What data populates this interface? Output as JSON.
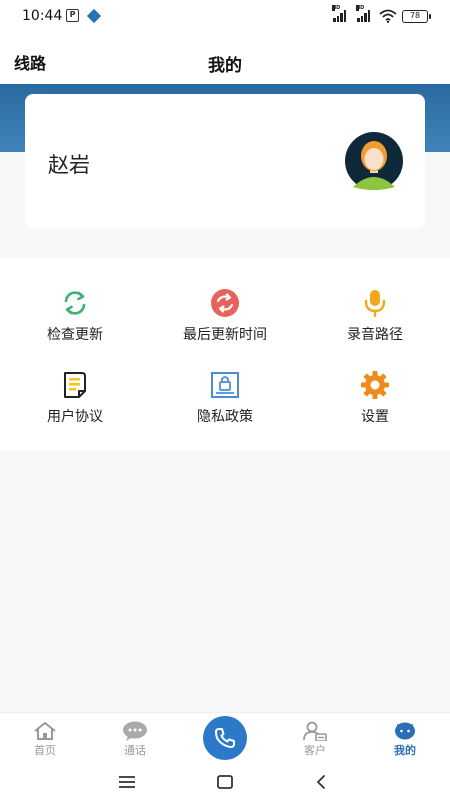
{
  "status_bar": {
    "time": "10:44",
    "battery": "78",
    "network_label": "HD"
  },
  "header": {
    "left_label": "线路",
    "title": "我的"
  },
  "profile": {
    "name": "赵岩"
  },
  "menu": {
    "items": [
      {
        "label": "检查更新",
        "icon": "refresh-icon",
        "color": "#3cb371"
      },
      {
        "label": "最后更新时间",
        "icon": "sync-circle-icon",
        "color": "#e8615a"
      },
      {
        "label": "录音路径",
        "icon": "microphone-icon",
        "color": "#f2a81d"
      },
      {
        "label": "用户协议",
        "icon": "document-icon",
        "color": "#f5c518"
      },
      {
        "label": "隐私政策",
        "icon": "privacy-lock-icon",
        "color": "#4a8fd4"
      },
      {
        "label": "设置",
        "icon": "gear-icon",
        "color": "#f08a1c"
      }
    ]
  },
  "bottom_nav": {
    "items": [
      {
        "label": "首页",
        "icon": "home-icon"
      },
      {
        "label": "通话",
        "icon": "chat-bubble-icon"
      },
      {
        "label": "客户",
        "icon": "customer-icon"
      },
      {
        "label": "我的",
        "icon": "mine-icon",
        "active": true
      }
    ],
    "accent": "#2d6fb7"
  },
  "colors": {
    "brand_blue": "#2b79c8",
    "band_blue": "#3f83bb"
  }
}
